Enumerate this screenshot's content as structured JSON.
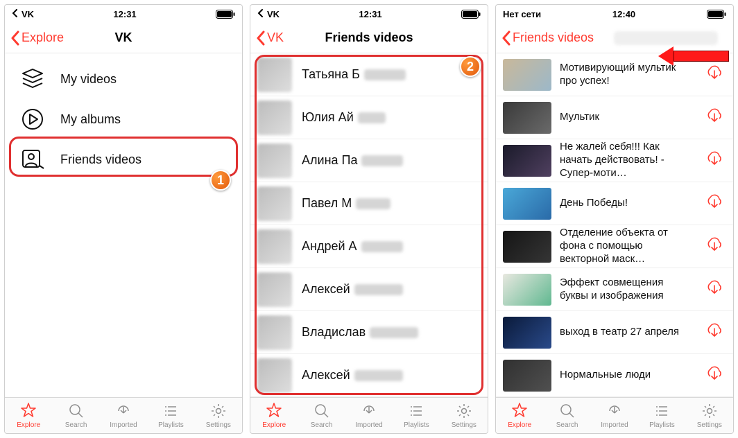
{
  "screen1": {
    "status": {
      "left": "VK",
      "time": "12:31"
    },
    "nav": {
      "back": "Explore",
      "title": "VK"
    },
    "menu": [
      {
        "label": "My videos"
      },
      {
        "label": "My albums"
      },
      {
        "label": "Friends videos"
      }
    ],
    "badge": "1"
  },
  "screen2": {
    "status": {
      "left": "VK",
      "time": "12:31"
    },
    "nav": {
      "back": "VK",
      "title": "Friends videos"
    },
    "friends": [
      {
        "first": "Татьяна",
        "lastVisible": "Б",
        "blurW": 60
      },
      {
        "first": "Юлия",
        "lastVisible": "Ай",
        "blurW": 40
      },
      {
        "first": "Алина",
        "lastVisible": "Па",
        "blurW": 60
      },
      {
        "first": "Павел",
        "lastVisible": "М",
        "blurW": 50
      },
      {
        "first": "Андрей",
        "lastVisible": "А",
        "blurW": 60
      },
      {
        "first": "Алексей",
        "lastVisible": "",
        "blurW": 70
      },
      {
        "first": "Владислав",
        "lastVisible": "",
        "blurW": 70
      },
      {
        "first": "Алексей",
        "lastVisible": "",
        "blurW": 70
      }
    ],
    "badge": "2"
  },
  "screen3": {
    "status": {
      "left": "Нет сети",
      "time": "12:40"
    },
    "nav": {
      "back": "Friends videos"
    },
    "videos": [
      {
        "title": "Мотивирующий мультик про успех!",
        "thumb": "linear-gradient(135deg,#c9b89a,#9cb8c9)"
      },
      {
        "title": "Мультик",
        "thumb": "linear-gradient(135deg,#3a3a3a,#6a6a6a)"
      },
      {
        "title": "Не жалей себя!!! Как начать действовать! - Супер-моти…",
        "thumb": "linear-gradient(135deg,#1a1a2a,#504060)"
      },
      {
        "title": "День Победы!",
        "thumb": "linear-gradient(135deg,#4aa8d8,#2a6aa8)"
      },
      {
        "title": "Отделение объекта от фона с помощью векторной маск…",
        "thumb": "linear-gradient(135deg,#151515,#353535)"
      },
      {
        "title": "Эффект совмещения буквы и изображения",
        "thumb": "linear-gradient(135deg,#e8e8e0,#60b890)"
      },
      {
        "title": "выход в театр 27 апреля",
        "thumb": "linear-gradient(135deg,#0a1a3a,#2a4a8a)"
      },
      {
        "title": "Нормальные люди",
        "thumb": "linear-gradient(135deg,#303030,#505050)"
      }
    ]
  },
  "tabs": [
    {
      "label": "Explore"
    },
    {
      "label": "Search"
    },
    {
      "label": "Imported"
    },
    {
      "label": "Playlists"
    },
    {
      "label": "Settings"
    }
  ]
}
